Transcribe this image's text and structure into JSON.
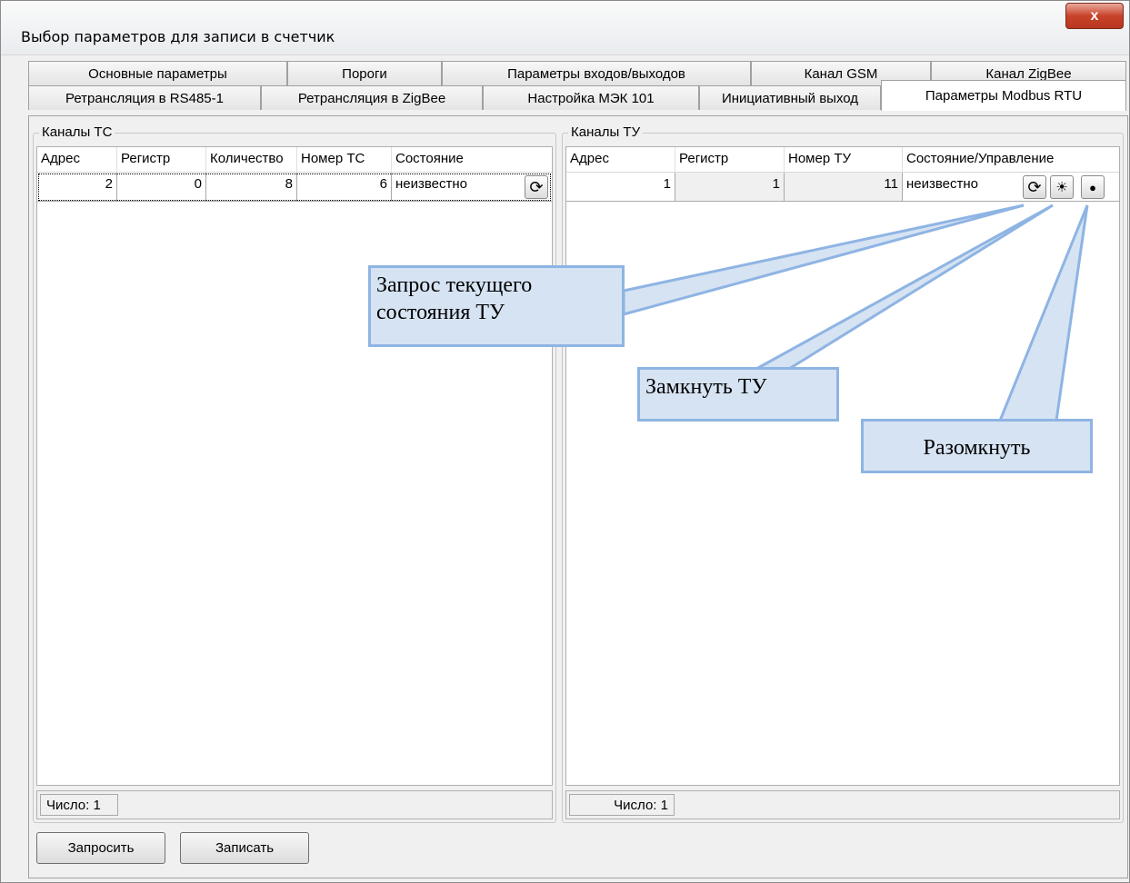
{
  "window": {
    "title": "Выбор параметров для записи в счетчик",
    "close_label": "x"
  },
  "tabs": {
    "row1": [
      "Основные параметры",
      "Пороги",
      "Параметры входов/выходов",
      "Канал GSM",
      "Канал ZigBee"
    ],
    "row2": [
      "Ретрансляция в RS485-1",
      "Ретрансляция в ZigBee",
      "Настройка МЭК 101",
      "Инициативный выход",
      "Параметры Modbus RTU"
    ],
    "active": "Параметры Modbus RTU"
  },
  "tc": {
    "legend": "Каналы ТС",
    "columns": [
      "Адрес",
      "Регистр",
      "Количество",
      "Номер ТС",
      "Состояние"
    ],
    "rows": [
      {
        "address": "2",
        "register": "0",
        "count": "8",
        "number": "6",
        "state": "неизвестно"
      }
    ],
    "count_label": "Число: 1",
    "refresh_icon": "refresh-icon"
  },
  "tu": {
    "legend": "Каналы ТУ",
    "columns": [
      "Адрес",
      "Регистр",
      "Номер ТУ",
      "Состояние/Управление"
    ],
    "rows": [
      {
        "address": "1",
        "register": "1",
        "number": "11",
        "state": "неизвестно"
      }
    ],
    "count_label": "Число: 1",
    "icons": [
      "refresh-icon",
      "bulb-on-icon",
      "bulb-off-icon"
    ]
  },
  "buttons": {
    "request": "Запросить",
    "write": "Записать"
  },
  "callouts": {
    "request_state": "Запрос текущего состояния ТУ",
    "close_tu": "Замкнуть ТУ",
    "open_tu": "Разомкнуть"
  },
  "colors": {
    "callout_fill": "#d6e3f3",
    "callout_border": "#8eb4e3",
    "close_button": "#c7432a"
  }
}
